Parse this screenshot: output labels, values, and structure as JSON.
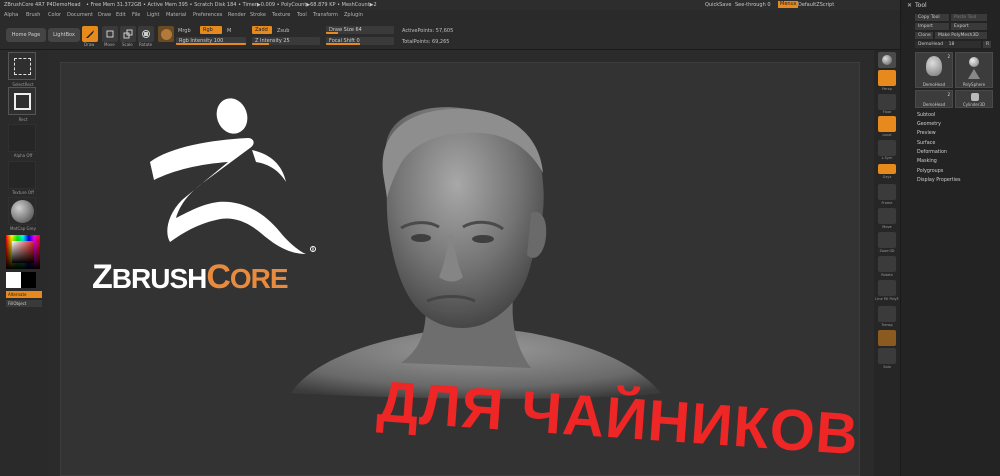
{
  "titlebar": {
    "app_title": "ZBrushCore 4R7 P4DemoHead",
    "stats": "• Free Mem 31.372GB • Active Mem 395 • Scratch Disk 184 • Timer▶0.009 • PolyCount▶68.879 KP • MeshCount▶2",
    "quicksave": "QuickSave",
    "seethrough": "See-through  0",
    "menus_btn": "Menus",
    "script": "DefaultZScript"
  },
  "menubar": {
    "items": [
      "Alpha",
      "Brush",
      "Color",
      "Document",
      "Draw",
      "Edit",
      "File",
      "Light",
      "Material",
      "Preferences",
      "Render",
      "Stroke",
      "Texture",
      "Tool",
      "Transform",
      "Zplugin"
    ]
  },
  "top_shelf": {
    "home_page": "Home Page",
    "lightbox": "LightBox",
    "draw": "Draw",
    "move": "Move",
    "scale": "Scale",
    "rotate": "Rotate",
    "mrgb": "Mrgb",
    "rgb": "Rgb",
    "m": "M",
    "rgb_intensity": "Rgb Intensity 100",
    "zadd": "Zadd",
    "zsub": "Zsub",
    "z_intensity": "Z Intensity 25",
    "draw_size": "Draw Size 64",
    "focal_shift": "Focal Shift 0",
    "active_points": "ActivePoints: 57,605",
    "total_points": "TotalPoints: 69,265"
  },
  "left_shelf": {
    "select_rect": "SelectRect",
    "rect": "Rect",
    "alpha_off": "Alpha Off",
    "texture_off": "Texture Off",
    "matcap": "MatCap Grey",
    "alternate": "Alternate",
    "fill_object": "FillObject"
  },
  "right_shelf": {
    "items": [
      "Persp",
      "Floor",
      "Local",
      "L.Sym",
      "Gxyz",
      "Frame",
      "Move",
      "Zoom3D",
      "Rotate",
      "Line Fill PolyF",
      "Transp",
      "Solo"
    ]
  },
  "tool_panel": {
    "title": "Tool",
    "copy_tool": "Copy Tool",
    "paste_tool": "Paste Tool",
    "import": "Import",
    "export": "Export",
    "clone": "Clone",
    "make_polymesh": "Make PolyMesh3D",
    "demohead_label": "DemoHead",
    "demohead_value": "18",
    "r_btn": "R",
    "thumbs": [
      {
        "name": "DemoHead",
        "num": "2"
      },
      {
        "name": "PolySphere",
        "num": ""
      },
      {
        "name": "DemoHead",
        "num": "2"
      },
      {
        "name": "Cylinder3D",
        "num": ""
      }
    ],
    "sections": [
      "Subtool",
      "Geometry",
      "Preview",
      "Surface",
      "Deformation",
      "Masking",
      "Polygroups",
      "Display Properties"
    ]
  },
  "overlay": {
    "logo_z": "Z",
    "logo_brush": "BRUSH",
    "logo_c": "C",
    "logo_ore": "ORE",
    "reg": "R",
    "headline": "ДЛЯ ЧАЙНИКОВ"
  },
  "colors": {
    "accent": "#e68a1e",
    "headline": "#ee2626",
    "logo_core": "#e88b3e"
  }
}
